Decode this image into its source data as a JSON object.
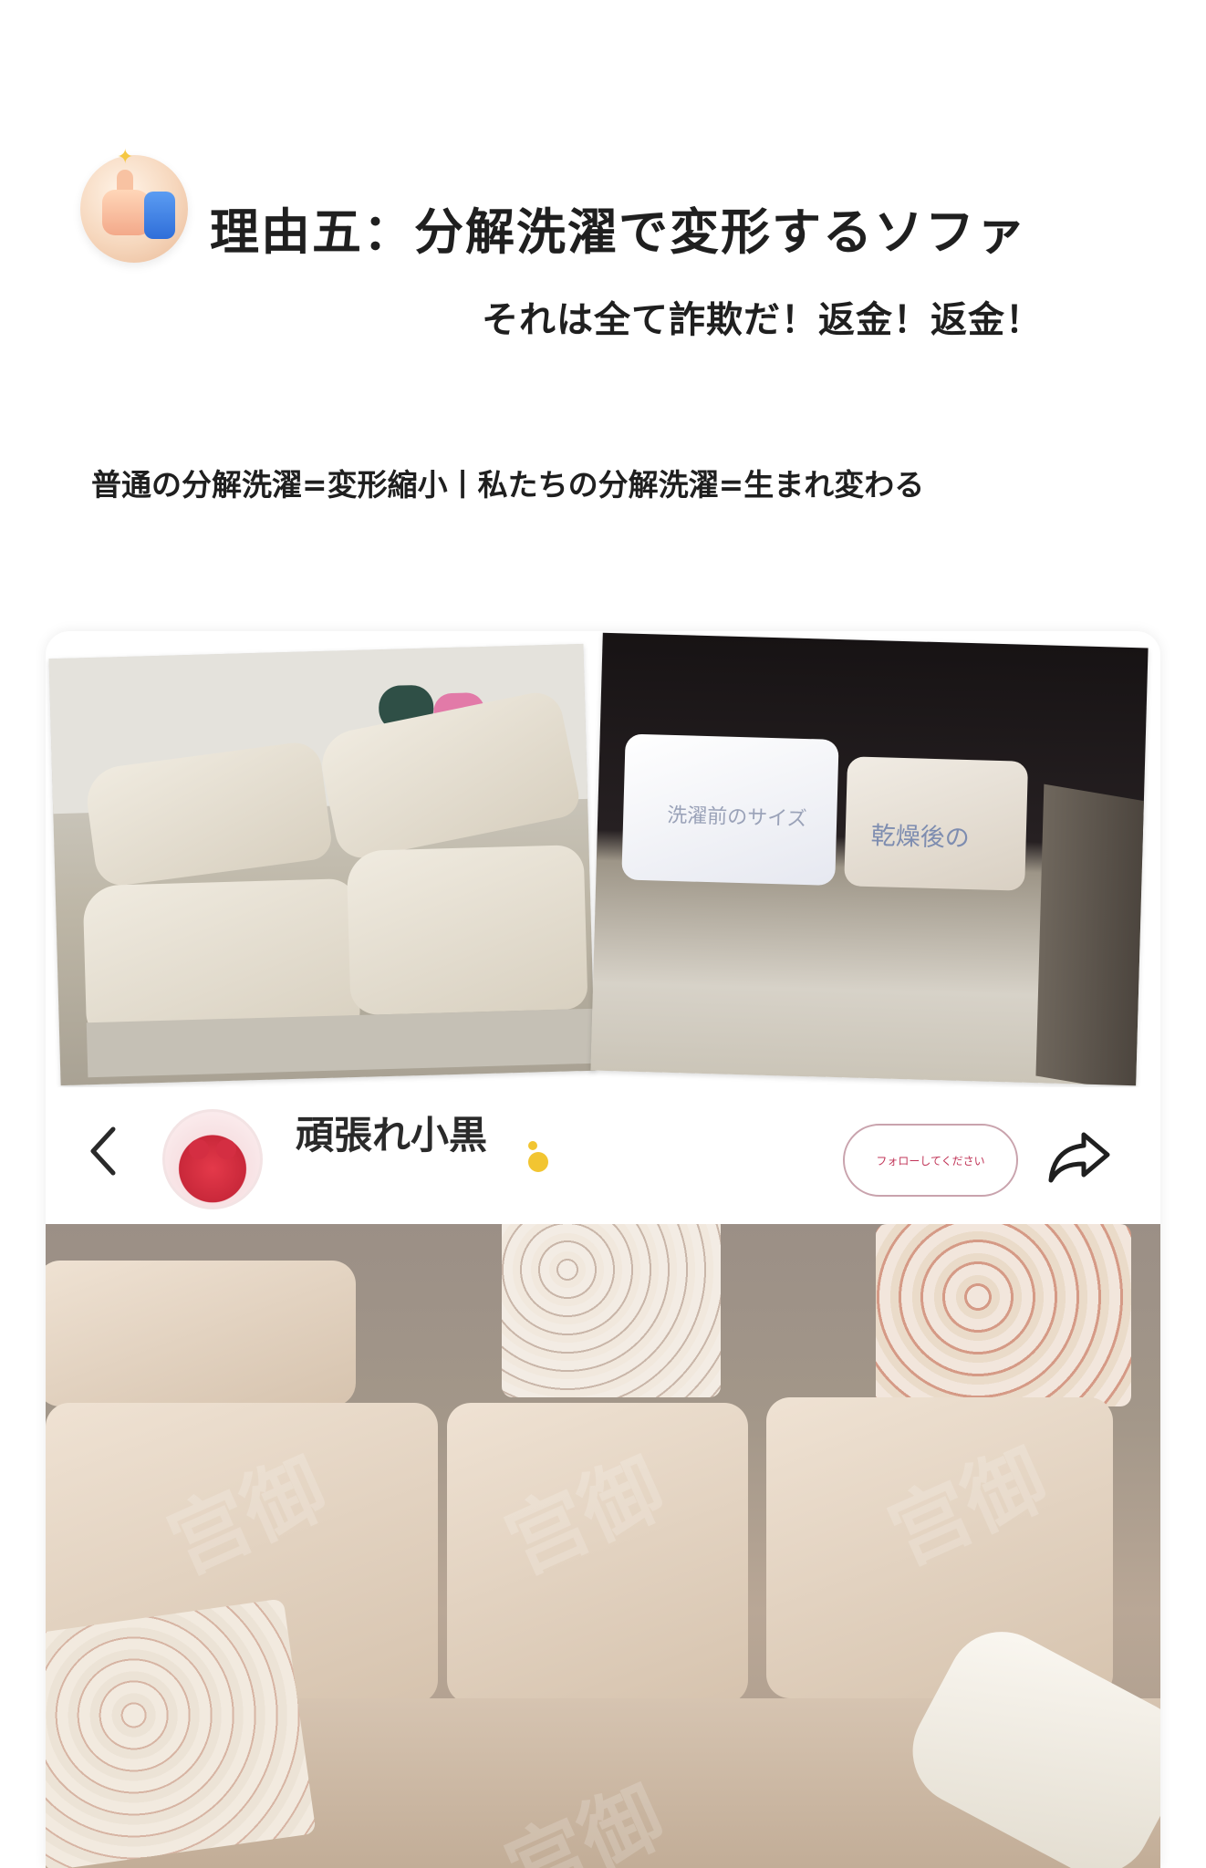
{
  "header": {
    "title": "理由五：分解洗濯で変形するソファ",
    "subtitle": "それは全て詐欺だ！返金！返金！",
    "comparison": "普通の分解洗濯=変形縮小丨私たちの分解洗濯=生まれ変わる"
  },
  "card": {
    "photo_after_labels": {
      "before": "洗濯前のサイズ",
      "after": "乾燥後の"
    },
    "user": {
      "name": "頑張れ小黒",
      "follow_label": "フォローしてください"
    },
    "watermark": "宫御"
  },
  "colors": {
    "follow_border": "#c9a3ad",
    "follow_text": "#c13558",
    "text": "#1f1f1f"
  },
  "icons": [
    "thumbs-up-icon",
    "back-chevron-icon",
    "user-status-dot-icon",
    "share-icon"
  ]
}
